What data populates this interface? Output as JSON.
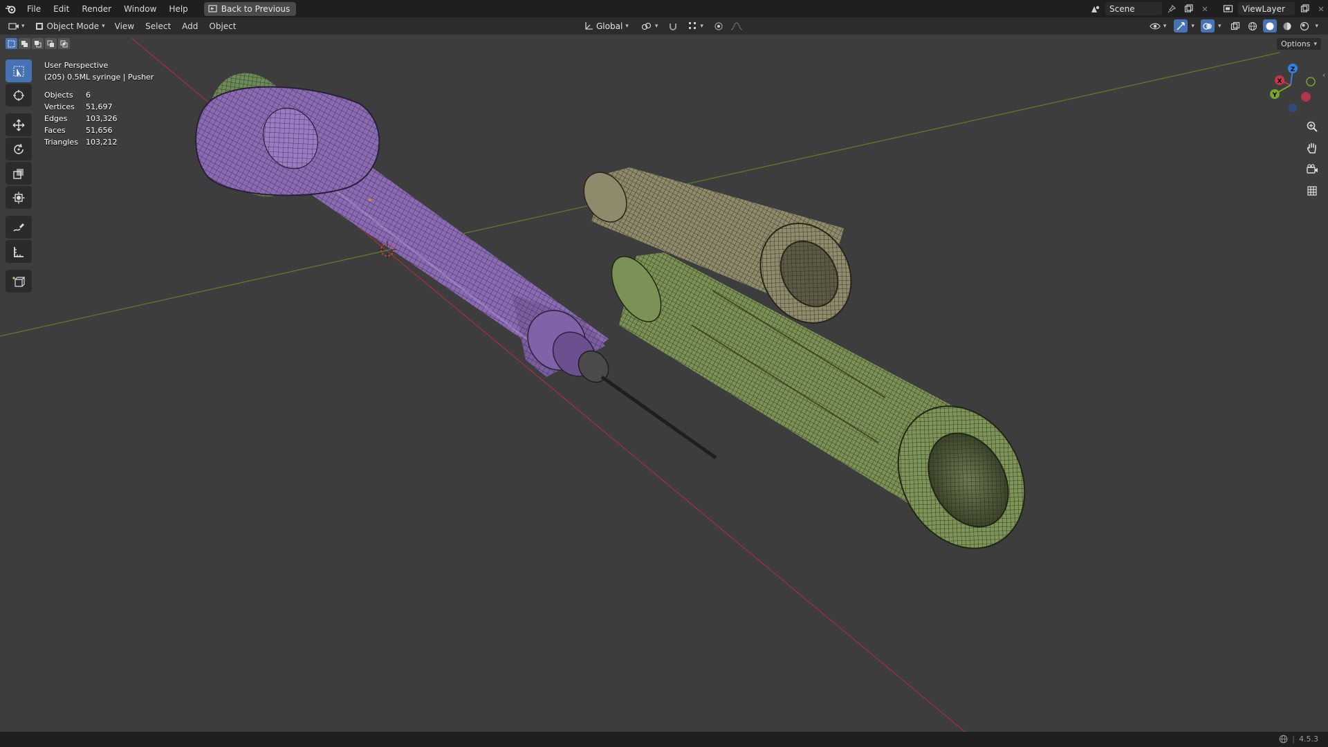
{
  "topbar": {
    "menu": [
      "File",
      "Edit",
      "Render",
      "Window",
      "Help"
    ],
    "back_button": "Back to Previous",
    "scene": "Scene",
    "view_layer": "ViewLayer"
  },
  "viewport_header": {
    "mode": "Object Mode",
    "menus": [
      "View",
      "Select",
      "Add",
      "Object"
    ],
    "transform_orientation": "Global",
    "options": "Options"
  },
  "overlay": {
    "view_name": "User Perspective",
    "active": "(205) 0.5ML syringe | Pusher",
    "stats": [
      {
        "label": "Objects",
        "value": "6"
      },
      {
        "label": "Vertices",
        "value": "51,697"
      },
      {
        "label": "Edges",
        "value": "103,326"
      },
      {
        "label": "Faces",
        "value": "51,656"
      },
      {
        "label": "Triangles",
        "value": "103,212"
      }
    ]
  },
  "gizmo": {
    "x": "X",
    "y": "Y",
    "z": "Z"
  },
  "status": {
    "version": "4.5.3"
  },
  "colors": {
    "accent": "#4772b3",
    "x_axis": "#c8344a",
    "y_axis": "#7aa52c",
    "z_axis": "#2e83e0",
    "plunger": "#8a6ab2",
    "barrel_green": "#7c9155",
    "cap_tan": "#8e8a6b"
  },
  "icons": {
    "tools": [
      "select-box-icon",
      "cursor-icon",
      "move-icon",
      "rotate-icon",
      "scale-icon",
      "transform-icon",
      "annotate-icon",
      "measure-icon",
      "add-cube-icon"
    ],
    "nav": [
      "zoom-icon",
      "hand-pan-icon",
      "camera-icon",
      "grid-view-icon"
    ]
  }
}
